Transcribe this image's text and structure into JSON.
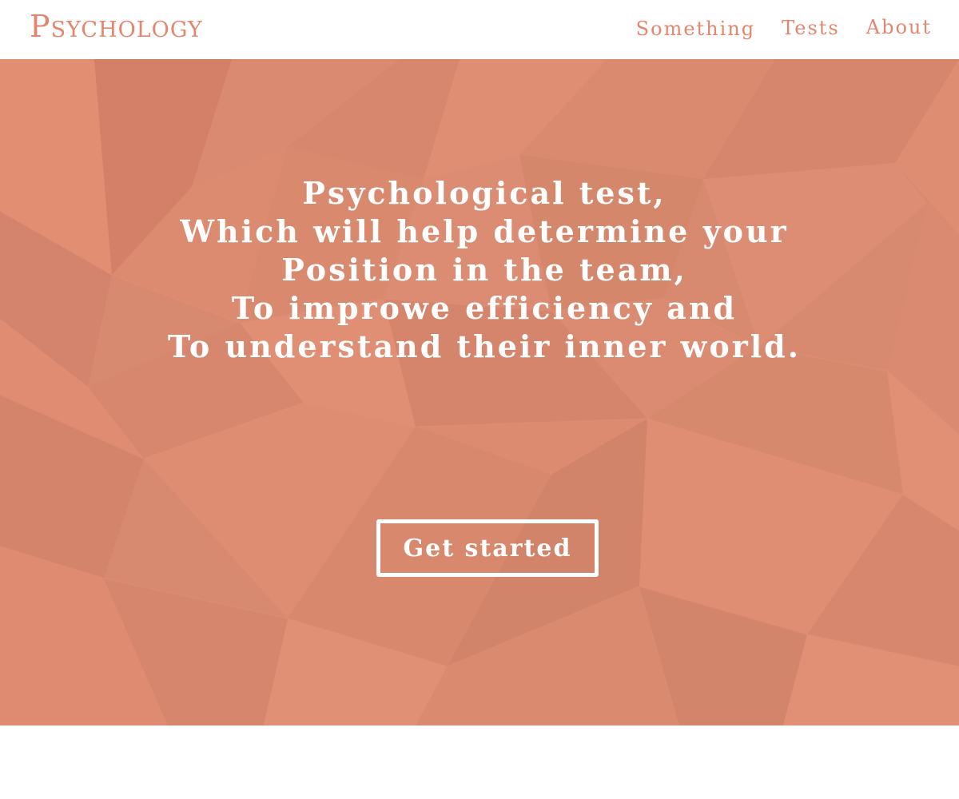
{
  "colors": {
    "accent": "#E3866E",
    "hero_base": "#D88A70",
    "background": "#FFFFFF",
    "hero_text": "#FFFFFF"
  },
  "header": {
    "logo": "Psychology",
    "nav": [
      {
        "label": "Something"
      },
      {
        "label": "Tests"
      },
      {
        "label": "About"
      }
    ]
  },
  "hero": {
    "lines": [
      "Psychological test,",
      "Which will help determine your",
      "Position in the team,",
      "To improwe efficiency and",
      "To understand their inner world."
    ],
    "button_label": "Get started"
  }
}
